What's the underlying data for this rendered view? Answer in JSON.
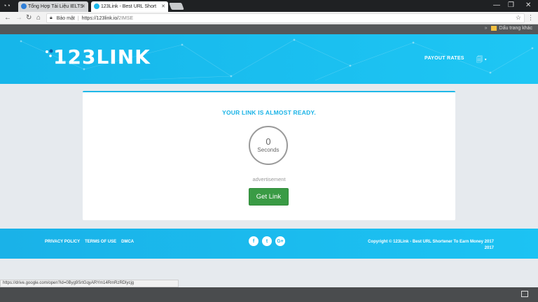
{
  "browser": {
    "tabs": [
      {
        "title": "Tổng Hợp Tài Liệu IELTS",
        "active": false,
        "favicon_color": "#2f7fd8"
      },
      {
        "title": "123Link - Best URL Short",
        "active": true,
        "favicon_color": "#1cb8ea"
      }
    ],
    "address": {
      "secure_label": "Bảo mật",
      "url_host": "https://123link.io/",
      "url_path": "2IMSE"
    },
    "bookmarks": {
      "other_label": "Dấu trang khác"
    },
    "status_url": "https://drive.google.com/open?id=0Byg9SrtGqyARYm14RmRzRDlycjg"
  },
  "site": {
    "logo_text": "123LINK",
    "nav": {
      "payout_rates": "PAYOUT RATES"
    },
    "card": {
      "title": "YOUR LINK IS ALMOST READY.",
      "countdown_value": "0",
      "countdown_unit": "Seconds",
      "ad_label": "advertisement",
      "get_link_label": "Get Link"
    },
    "footer": {
      "links": [
        "PRIVACY POLICY",
        "TERMS OF USE",
        "DMCA"
      ],
      "social": [
        {
          "name": "facebook-icon",
          "glyph": "f"
        },
        {
          "name": "twitter-icon",
          "glyph": "t"
        },
        {
          "name": "google-plus-icon",
          "glyph": "G+"
        }
      ],
      "copyright_line1": "Copyright © 123Link - Best URL Shortener To Earn Money 2017",
      "copyright_line2": "2017"
    }
  },
  "colors": {
    "accent": "#1ab3e6",
    "button_green": "#3a9b45"
  }
}
